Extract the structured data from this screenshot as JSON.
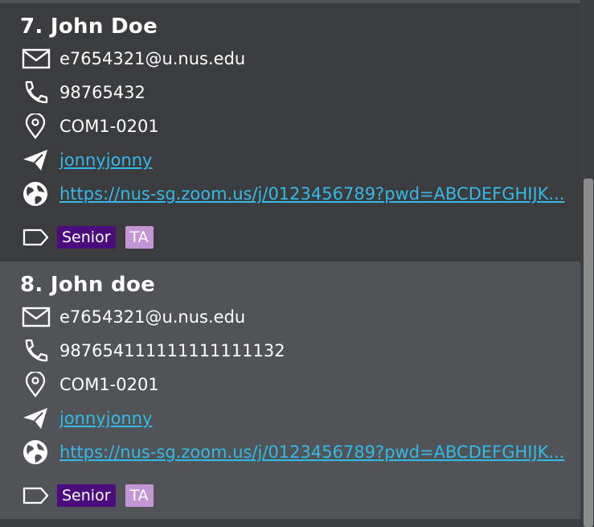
{
  "persons": [
    {
      "index_name": "7.  John Doe",
      "email": "e7654321@u.nus.edu",
      "phone": "98765432",
      "address": "COM1-0201",
      "telegram": "jonnyjonny",
      "link": "https://nus-sg.zoom.us/j/0123456789?pwd=ABCDEFGHIJK...",
      "tags": [
        "Senior",
        "TA"
      ]
    },
    {
      "index_name": "8.  John doe",
      "email": "e7654321@u.nus.edu",
      "phone": "987654111111111111132",
      "address": "COM1-0201",
      "telegram": "jonnyjonny",
      "link": "https://nus-sg.zoom.us/j/0123456789?pwd=ABCDEFGHIJK...",
      "tags": [
        "Senior",
        "TA"
      ]
    }
  ],
  "colors": {
    "card_dark": "#3b3c3e",
    "card_light": "#505456",
    "link": "#35b9e9",
    "tag_senior": "#4b0d7e",
    "tag_ta": "#c596d5"
  },
  "icons": [
    "mail-icon",
    "phone-icon",
    "location-pin-icon",
    "telegram-icon",
    "globe-icon",
    "tag-icon"
  ]
}
